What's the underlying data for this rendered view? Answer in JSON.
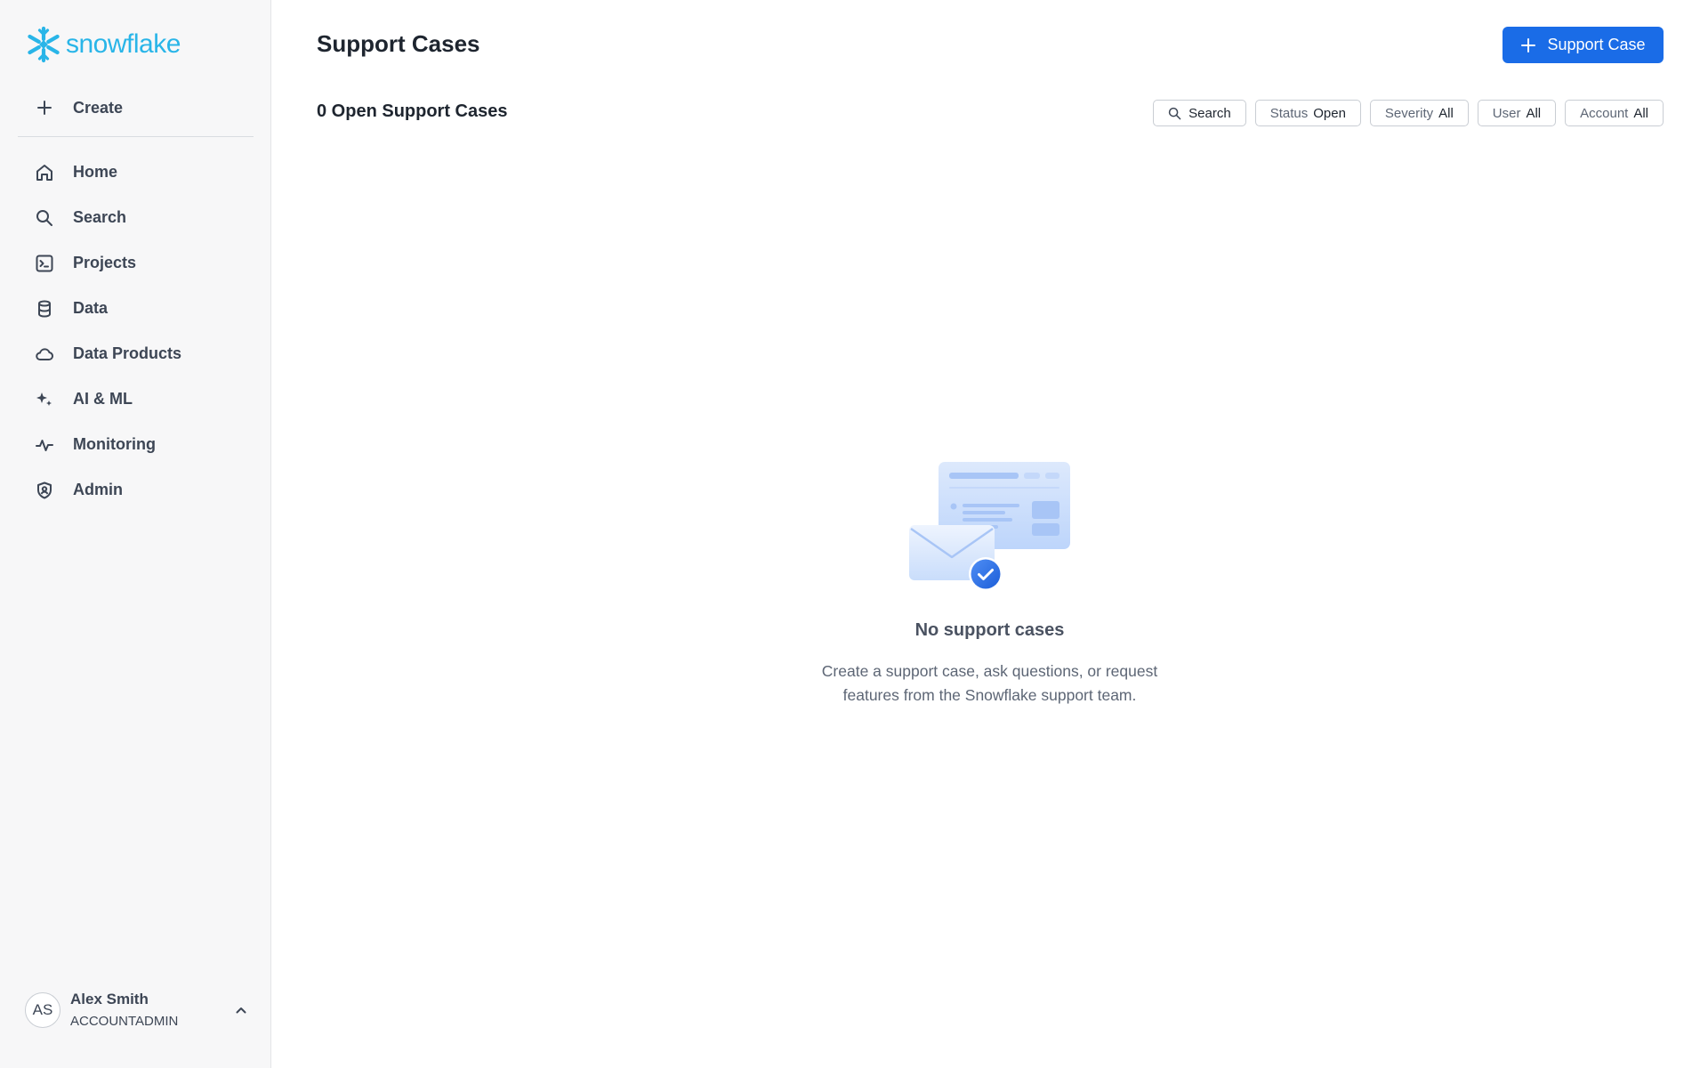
{
  "brand": {
    "logo_text": "snowflake",
    "color": "#29b5e8"
  },
  "sidebar": {
    "create_label": "Create",
    "items": [
      {
        "label": "Home",
        "icon": "home-icon"
      },
      {
        "label": "Search",
        "icon": "search-icon"
      },
      {
        "label": "Projects",
        "icon": "terminal-icon"
      },
      {
        "label": "Data",
        "icon": "database-icon"
      },
      {
        "label": "Data Products",
        "icon": "cloud-icon"
      },
      {
        "label": "AI & ML",
        "icon": "sparkle-icon"
      },
      {
        "label": "Monitoring",
        "icon": "activity-icon"
      },
      {
        "label": "Admin",
        "icon": "shield-icon"
      }
    ],
    "user": {
      "initials": "AS",
      "name": "Alex Smith",
      "role": "ACCOUNTADMIN"
    }
  },
  "main": {
    "title": "Support Cases",
    "primary_button": "Support Case",
    "count_heading": "0 Open Support Cases",
    "filters": {
      "search_label": "Search",
      "status": {
        "label": "Status",
        "value": "Open"
      },
      "severity": {
        "label": "Severity",
        "value": "All"
      },
      "user": {
        "label": "User",
        "value": "All"
      },
      "account": {
        "label": "Account",
        "value": "All"
      }
    },
    "empty_state": {
      "title": "No support cases",
      "description": "Create a support case, ask questions, or request features from the Snowflake support team."
    }
  },
  "colors": {
    "accent": "#1a6ce7",
    "sidebar_bg": "#f7f7f8"
  }
}
